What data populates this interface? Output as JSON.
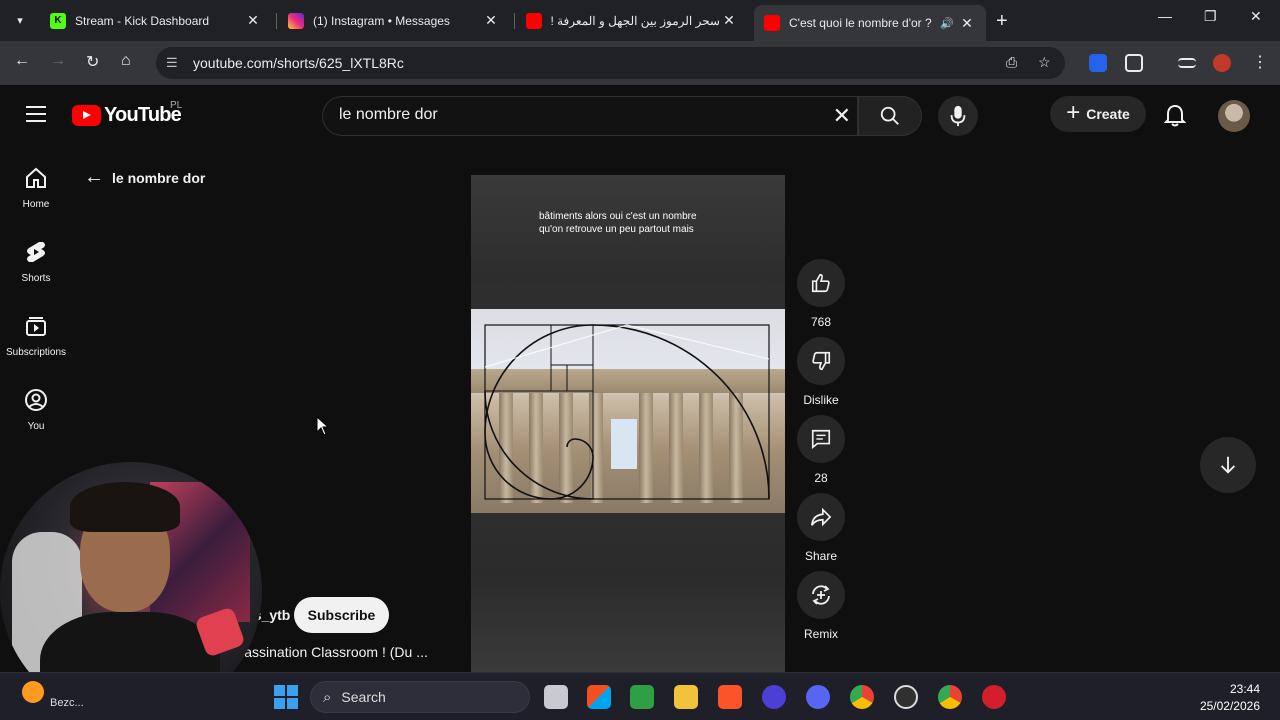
{
  "browser": {
    "tabs": [
      {
        "title": "Stream - Kick Dashboard",
        "favicon_color": "#53fc18",
        "favicon_label": "K"
      },
      {
        "title": "(1) Instagram • Messages",
        "favicon_color": "#e1306c",
        "favicon_label": ""
      },
      {
        "title": "سحر الرموز بين الجهل و المعرفة !!",
        "favicon_color": "#ff0000",
        "favicon_label": ""
      },
      {
        "title": "C'est quoi le nombre d'or ?",
        "favicon_color": "#ff0000",
        "favicon_label": ""
      }
    ],
    "url": "youtube.com/shorts/625_lXTL8Rc"
  },
  "youtube": {
    "logo_word": "YouTube",
    "country_code": "PL",
    "search_value": "le nombre dor",
    "create_label": "Create",
    "nav": [
      {
        "label": "Home",
        "icon": "home-icon"
      },
      {
        "label": "Shorts",
        "icon": "shorts-icon"
      },
      {
        "label": "Subscriptions",
        "icon": "subscriptions-icon"
      },
      {
        "label": "You",
        "icon": "you-icon"
      }
    ],
    "back_label": "le nombre dor"
  },
  "short": {
    "caption_line1": "bâtiments alors oui c'est un nombre",
    "caption_line2": "qu'on retrouve un peu partout mais",
    "channel": "es_ytb",
    "subscribe_label": "Subscribe",
    "video_title": "n Assassination Classroom ! (Du ...",
    "actions": {
      "like_count": "768",
      "dislike_label": "Dislike",
      "comment_count": "28",
      "share_label": "Share",
      "remix_label": "Remix"
    }
  },
  "taskbar": {
    "search_placeholder": "Search",
    "weather_text": "Bezc...",
    "time": "23:44",
    "date": "25/02/2026"
  }
}
